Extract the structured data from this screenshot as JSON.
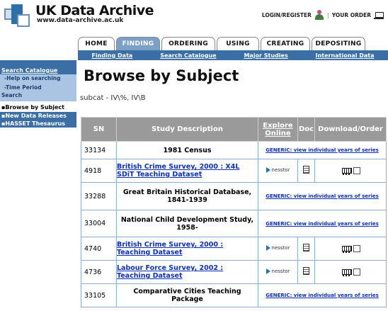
{
  "header": {
    "brand": "UK Data Archive",
    "url": "www.data-archive.ac.uk",
    "login_label": "LOGIN/REGISTER",
    "order_label": "YOUR ORDER"
  },
  "tabs": [
    {
      "label": "HOME",
      "active": false
    },
    {
      "label": "FINDING",
      "active": true
    },
    {
      "label": "ORDERING",
      "active": false
    },
    {
      "label": "USING",
      "active": false
    },
    {
      "label": "CREATING",
      "active": false
    },
    {
      "label": "DEPOSITING",
      "active": false
    }
  ],
  "subnav": [
    "Finding Data",
    "Search Catalogue",
    "Major Studies",
    "International Data"
  ],
  "sidebar": {
    "head": "Search Catalogue",
    "sub1": "-Help on searching",
    "sub2a": "-Time Period",
    "sub2b": "Search",
    "browse": "▪Browse by Subject",
    "new_data": "▪New Data Releases",
    "hasset": "▪HASSET Thesaurus"
  },
  "main": {
    "title": "Browse by Subject",
    "subcat": "subcat - IV\\%, IV\\B"
  },
  "table": {
    "headers": {
      "sn": "SN",
      "desc": "Study Description",
      "explore": "Explore Online",
      "doc": "Doc",
      "download": "Download/Order"
    },
    "nesstor_label": "nesstor",
    "generic_label": "GENERIC: view individual years of series",
    "rows": [
      {
        "sn": "33134",
        "desc": "1981 Census"
      },
      {
        "sn": "4918",
        "desc": "British Crime Survey, 2000 : X4L SDiT Teaching Dataset"
      },
      {
        "sn": "33288",
        "desc": "Great Britain Historical Database, 1841-1939"
      },
      {
        "sn": "33004",
        "desc": "National Child Development Study, 1958-"
      },
      {
        "sn": "4740",
        "desc": "British Crime Survey, 2000 : Teaching Dataset"
      },
      {
        "sn": "4736",
        "desc": "Labour Force Survey, 2002 : Teaching Dataset"
      },
      {
        "sn": "33105",
        "desc": "Comparative Cities Teaching Package"
      }
    ]
  }
}
